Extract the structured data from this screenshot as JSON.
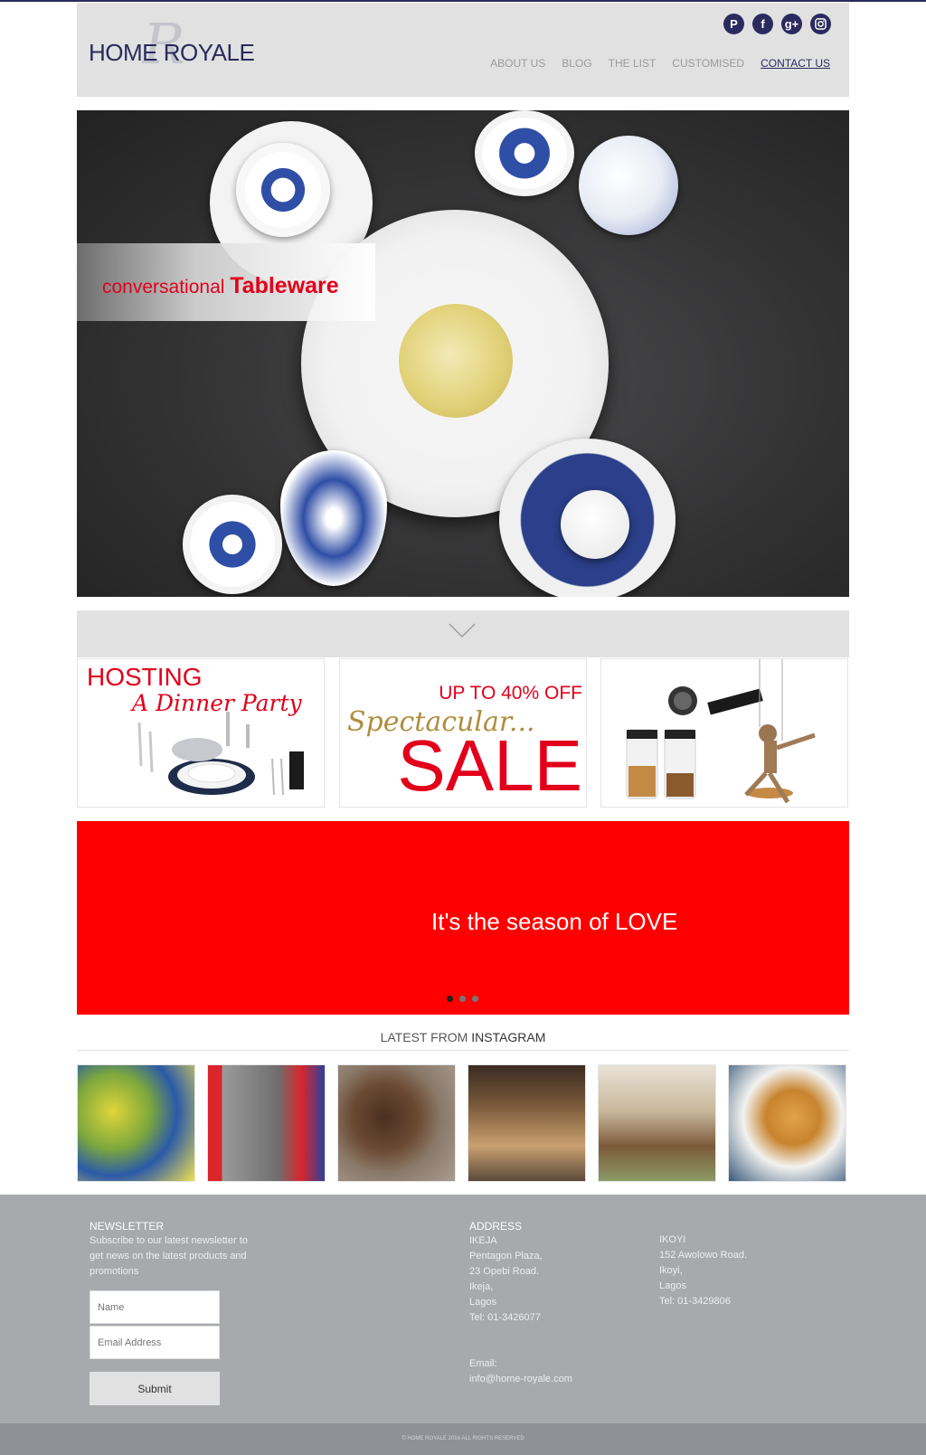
{
  "brand": {
    "logo_text": "HOME ROYALE",
    "logo_monogram": "R",
    "navy": "#2b2a5e",
    "red": "#e2001a"
  },
  "social": [
    {
      "name": "pinterest-icon",
      "glyph": "P"
    },
    {
      "name": "facebook-icon",
      "glyph": "f"
    },
    {
      "name": "google-plus-icon",
      "glyph": "g+"
    },
    {
      "name": "instagram-icon",
      "glyph": ""
    }
  ],
  "nav": {
    "about": "ABOUT US",
    "blog": "BLOG",
    "list": "THE LIST",
    "customised": "CUSTOMISED",
    "contact": "CONTACT US",
    "active": "CONTACT US"
  },
  "hero": {
    "caption_light": "conversational ",
    "caption_bold": "Tableware"
  },
  "scroll_icon": "chevron-down-icon",
  "promos": {
    "hosting": {
      "line1": "HOSTING",
      "line2": "A Dinner Party"
    },
    "sale": {
      "line1": "UP TO 40% OFF",
      "line2": "Spectacular...",
      "line3": "SALE"
    }
  },
  "banner": {
    "text": "It's the season of LOVE",
    "slides": 3,
    "active_slide": 1
  },
  "instagram": {
    "title_light": "LATEST FROM ",
    "title_bold": "INSTAGRAM"
  },
  "footer": {
    "newsletter": {
      "heading": "NEWSLETTER",
      "text": "Subscribe to our latest newsletter to get news on the latest products and promotions",
      "name_placeholder": "Name",
      "email_placeholder": "Email Address",
      "submit": "Submit"
    },
    "address": {
      "heading": "ADDRESS",
      "ikeja": [
        "IKEJA",
        "Pentagon Plaza,",
        "23 Opebi Road.",
        "Ikeja,",
        "Lagos",
        "Tel: 01-3426077"
      ],
      "email_label": "Email:",
      "email": "info@home-royale.com",
      "ikoyi": [
        "IKOYI",
        "152 Awolowo Road.",
        "Ikoyi,",
        "Lagos",
        "Tel: 01-3429806"
      ]
    },
    "copyright": "© Home Royale 2016 ALL RIGHTS RESERVED"
  }
}
